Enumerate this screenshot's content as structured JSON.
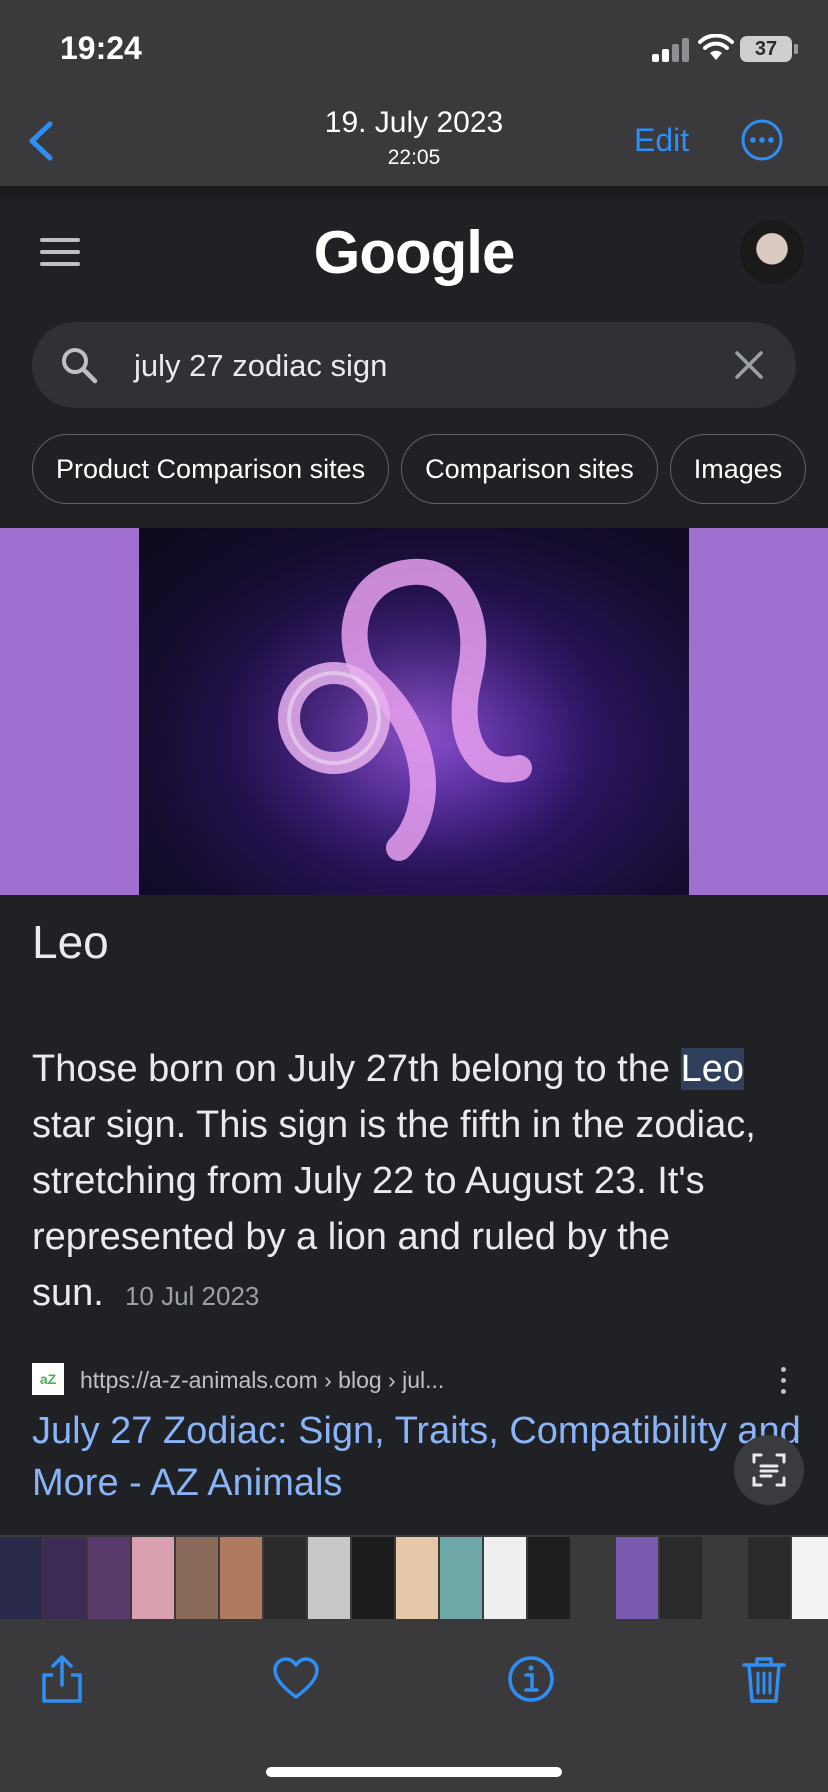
{
  "status_bar": {
    "time": "19:24",
    "battery": "37"
  },
  "nav": {
    "title": "19. July 2023",
    "subtitle": "22:05",
    "edit_label": "Edit"
  },
  "google": {
    "logo": "Google",
    "search_query": "july 27 zodiac sign",
    "chips": [
      "Product Comparison sites",
      "Comparison sites",
      "Images"
    ]
  },
  "result": {
    "title": "Leo",
    "desc_before": "Those born on July 27th belong to the ",
    "desc_highlight": "Leo",
    "desc_after": " star sign. This sign is the fifth in the zodiac, stretching from July 22 to August 23. It's represented by a lion and ruled by the sun.",
    "date": "10 Jul 2023",
    "favicon_text": "aZ",
    "url": "https://a-z-animals.com › blog › jul...",
    "link_title": "July 27 Zodiac: Sign, Traits, Compatibility and More - AZ Animals"
  },
  "colors": {
    "ios_blue": "#2f8ef4",
    "link_blue": "#8ab4f8",
    "hero_side": "#a070d0"
  },
  "thumb_colors": [
    "#2a2a4a",
    "#3b2b55",
    "#5a3a6a",
    "#d9a0b0",
    "#8a6a5a",
    "#b07a60",
    "#2a2a2a",
    "#c8c8c8",
    "#1c1c1c",
    "#e6c8a8",
    "#6fa8a8",
    "#efefef",
    "#1e1e1e",
    "#3a3a3c",
    "#7a5ab0",
    "#2a2a2a",
    "#3a3a3c",
    "#2a2a2a",
    "#f2f2f2",
    "#1c1c1c",
    "#b05a3a",
    "#e6e6e6",
    "#8a8a8a",
    "#f5f5f5",
    "#4a4a4a",
    "#c0b0a0",
    "#d0d0d0",
    "#2a2a2a",
    "#f0f0f0",
    "#1a1a1a"
  ],
  "icons": [
    "back-icon",
    "more-icon",
    "menu-icon",
    "avatar",
    "search-icon",
    "clear-icon",
    "lens-icon",
    "share-icon",
    "heart-icon",
    "info-icon",
    "trash-icon"
  ]
}
